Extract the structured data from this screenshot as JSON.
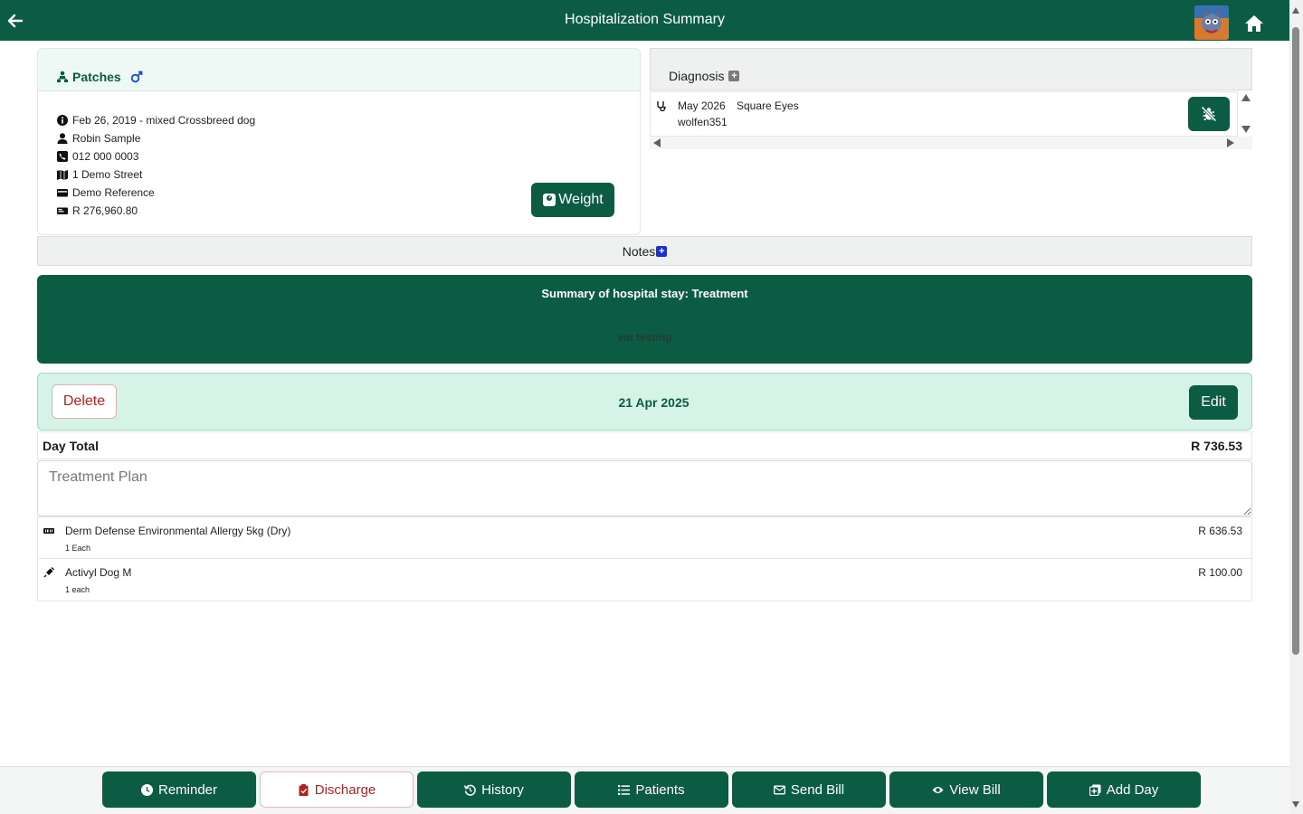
{
  "header": {
    "title": "Hospitalization Summary"
  },
  "patient": {
    "name": "Patches",
    "gender_icon": "male-icon",
    "dob_breed": "Feb 26, 2019 - mixed Crossbreed dog",
    "owner": "Robin Sample",
    "phone": "012 000 0003",
    "address": "1 Demo Street",
    "reference": "Demo Reference",
    "balance": "R 276,960.80",
    "weight_label": "Weight"
  },
  "diagnosis": {
    "title": "Diagnosis",
    "rows": [
      {
        "date": "May 2026",
        "name": "Square Eyes",
        "user": "wolfen351"
      }
    ]
  },
  "notes": {
    "label": "Notes"
  },
  "summary": {
    "title": "Summary of hospital stay: Treatment",
    "text": "vat testing"
  },
  "day": {
    "delete_label": "Delete",
    "date": "21 Apr 2025",
    "edit_label": "Edit",
    "total_label": "Day Total",
    "total_value": "R 736.53",
    "plan_placeholder": "Treatment Plan",
    "items": [
      {
        "icon": "product-icon",
        "name": "Derm Defense Environmental Allergy 5kg (Dry)",
        "qty": "1 Each",
        "price": "R 636.53"
      },
      {
        "icon": "syringe-icon",
        "name": "Activyl Dog M",
        "qty": "1 each",
        "price": "R 100.00"
      }
    ]
  },
  "bottom": {
    "reminder": "Reminder",
    "discharge": "Discharge",
    "history": "History",
    "patients": "Patients",
    "send_bill": "Send Bill",
    "view_bill": "View Bill",
    "add_day": "Add Day"
  },
  "colors": {
    "primary": "#0c5c44",
    "danger": "#b32020",
    "accent_blue": "#1a2fd6",
    "day_bg": "#d6f3e8"
  }
}
